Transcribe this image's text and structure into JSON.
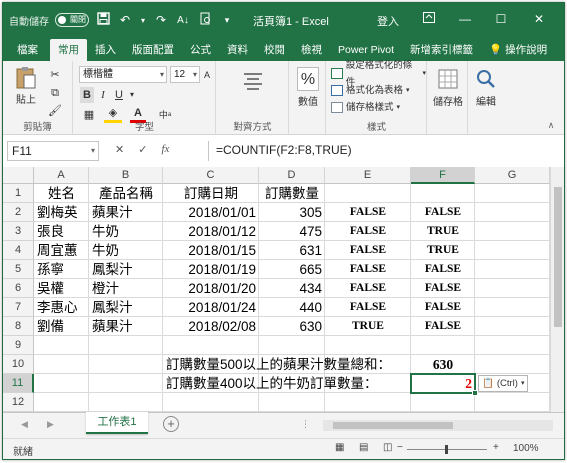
{
  "title_bar": {
    "autosave_label": "自動儲存",
    "autosave_state": "關閉",
    "doc_title": "活頁簿1 - Excel",
    "signin": "登入"
  },
  "tabs": [
    "檔案",
    "常用",
    "插入",
    "版面配置",
    "公式",
    "資料",
    "校閱",
    "檢視",
    "Power Pivot",
    "新增索引標籤",
    "操作說明"
  ],
  "active_tab": "常用",
  "ribbon": {
    "paste_label": "貼上",
    "clipboard_group": "剪貼簿",
    "font_name": "標楷體",
    "font_size": "12",
    "font_group": "字型",
    "align_group": "對齊方式",
    "number_label": "數值",
    "number_symbol": "%",
    "style_items": [
      "設定格式化的條件",
      "格式化為表格",
      "儲存格樣式"
    ],
    "style_group": "樣式",
    "cells_label": "儲存格",
    "edit_label": "編輯"
  },
  "formula_bar": {
    "name_box": "F11",
    "fx": "fx",
    "formula": "=COUNTIF(F2:F8,TRUE)"
  },
  "columns": [
    "A",
    "B",
    "C",
    "D",
    "E",
    "F",
    "G"
  ],
  "rows": [
    "1",
    "2",
    "3",
    "4",
    "5",
    "6",
    "7",
    "8",
    "9",
    "10",
    "11",
    "12"
  ],
  "headers": {
    "a": "姓名",
    "b": "產品名稱",
    "c": "訂購日期",
    "d": "訂購數量"
  },
  "data_rows": [
    {
      "a": "劉梅英",
      "b": "蘋果汁",
      "c": "2018/01/01",
      "d": "305",
      "e": "FALSE",
      "f": "FALSE"
    },
    {
      "a": "張良",
      "b": "牛奶",
      "c": "2018/01/12",
      "d": "475",
      "e": "FALSE",
      "f": "TRUE"
    },
    {
      "a": "周宜蕙",
      "b": "牛奶",
      "c": "2018/01/15",
      "d": "631",
      "e": "FALSE",
      "f": "TRUE"
    },
    {
      "a": "孫寧",
      "b": "鳳梨汁",
      "c": "2018/01/19",
      "d": "665",
      "e": "FALSE",
      "f": "FALSE"
    },
    {
      "a": "吳權",
      "b": "橙汁",
      "c": "2018/01/20",
      "d": "434",
      "e": "FALSE",
      "f": "FALSE"
    },
    {
      "a": "李惠心",
      "b": "鳳梨汁",
      "c": "2018/01/24",
      "d": "440",
      "e": "FALSE",
      "f": "FALSE"
    },
    {
      "a": "劉備",
      "b": "蘋果汁",
      "c": "2018/02/08",
      "d": "630",
      "e": "TRUE",
      "f": "FALSE"
    }
  ],
  "summary": {
    "label_10": "訂購數量500以上的蘋果汁數量總和：",
    "value_10": "630",
    "label_11": "訂購數量400以上的牛奶訂單數量：",
    "value_11": "2"
  },
  "paste_options": "(Ctrl)",
  "sheet_tab": "工作表1",
  "status": {
    "ready": "就緒",
    "zoom": "100%"
  }
}
